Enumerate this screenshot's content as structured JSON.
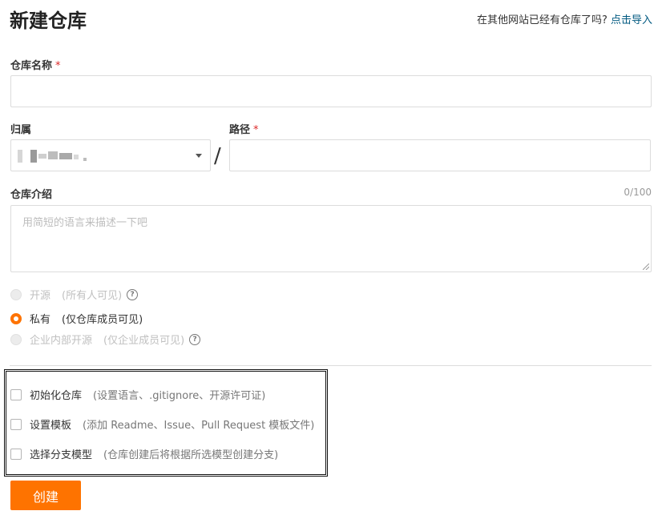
{
  "page": {
    "title": "新建仓库",
    "import_prompt": "在其他网站已经有仓库了吗?",
    "import_link": "点击导入"
  },
  "form": {
    "name_label": "仓库名称",
    "required_mark": "*",
    "owner_label": "归属",
    "path_label": "路径",
    "path_separator": "/",
    "desc_label": "仓库介绍",
    "desc_counter": "0/100",
    "desc_placeholder": "用简短的语言来描述一下吧"
  },
  "visibility": [
    {
      "label": "开源",
      "hint": "(所有人可见)",
      "state": "disabled",
      "help": "?"
    },
    {
      "label": "私有",
      "hint": "(仅仓库成员可见)",
      "state": "selected"
    },
    {
      "label": "企业内部开源",
      "hint": "(仅企业成员可见)",
      "state": "disabled",
      "help": "?"
    }
  ],
  "options": [
    {
      "label": "初始化仓库",
      "hint": "(设置语言、.gitignore、开源许可证)"
    },
    {
      "label": "设置模板",
      "hint": "(添加 Readme、Issue、Pull Request 模板文件)"
    },
    {
      "label": "选择分支模型",
      "hint": "(仓库创建后将根据所选模型创建分支)"
    }
  ],
  "submit_label": "创建",
  "colors": {
    "accent": "#fe7300",
    "link": "#005980",
    "required": "#db2828"
  }
}
